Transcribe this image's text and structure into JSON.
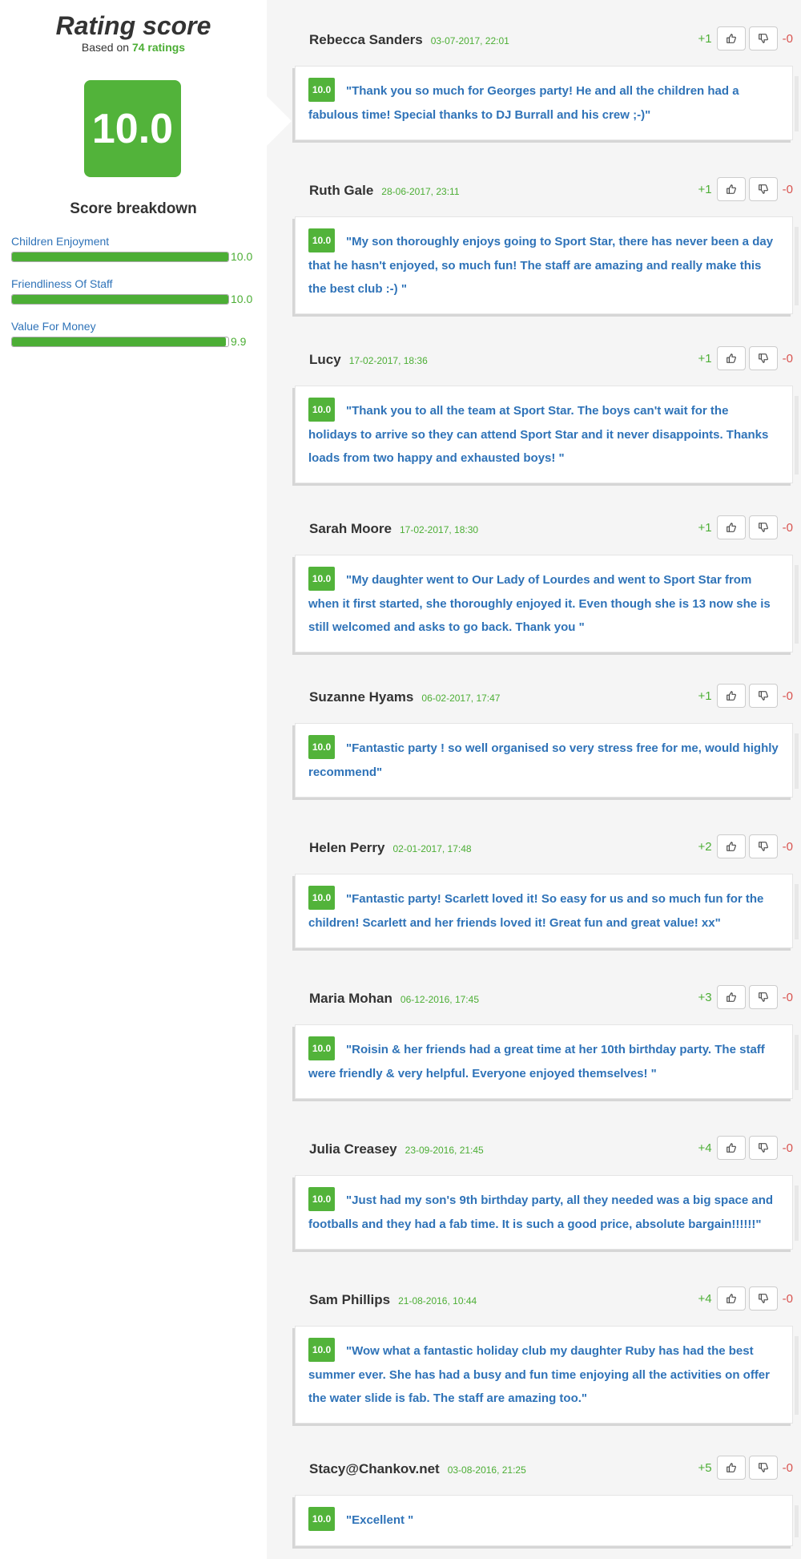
{
  "summary": {
    "title": "Rating score",
    "based_on_prefix": "Based on",
    "rating_count": "74 ratings",
    "score": "10.0"
  },
  "breakdown": {
    "title": "Score breakdown",
    "criteria": [
      {
        "label": "Children Enjoyment",
        "value": "10.0",
        "fraction": 1.0
      },
      {
        "label": "Friendliness Of Staff",
        "value": "10.0",
        "fraction": 1.0
      },
      {
        "label": "Value For Money",
        "value": "9.9",
        "fraction": 0.99
      }
    ]
  },
  "reviews": [
    {
      "author": "Rebecca Sanders",
      "date": "03-07-2017, 22:01",
      "up": "+1",
      "down": "-0",
      "score": "10.0",
      "text": "\"Thank you so much for Georges party! He and all the children had a fabulous time! Special thanks to DJ Burrall and his crew ;-)\""
    },
    {
      "author": "Ruth Gale",
      "date": "28-06-2017, 23:11",
      "up": "+1",
      "down": "-0",
      "score": "10.0",
      "text": "\"My son thoroughly enjoys going to Sport Star, there has never been a day that he hasn't enjoyed, so much fun! The staff are amazing and really make this the best club :-) \""
    },
    {
      "author": "Lucy",
      "date": "17-02-2017, 18:36",
      "up": "+1",
      "down": "-0",
      "score": "10.0",
      "text": "\"Thank you to all the team at Sport Star. The boys can't wait for the holidays to arrive so they can attend Sport Star and it never disappoints. Thanks loads from two happy and exhausted boys! \""
    },
    {
      "author": "Sarah Moore",
      "date": "17-02-2017, 18:30",
      "up": "+1",
      "down": "-0",
      "score": "10.0",
      "text": "\"My daughter went to Our Lady of Lourdes and went to Sport Star from when it first started, she thoroughly enjoyed it. Even though she is 13 now she is still welcomed and asks to go back. Thank you \""
    },
    {
      "author": "Suzanne Hyams",
      "date": "06-02-2017, 17:47",
      "up": "+1",
      "down": "-0",
      "score": "10.0",
      "text": "\"Fantastic party ! so well organised so very stress free for me, would highly recommend\""
    },
    {
      "author": "Helen Perry",
      "date": "02-01-2017, 17:48",
      "up": "+2",
      "down": "-0",
      "score": "10.0",
      "text": "\"Fantastic party! Scarlett loved it! So easy for us and so much fun for the children! Scarlett and her friends loved it! Great fun and great value! xx\""
    },
    {
      "author": "Maria Mohan",
      "date": "06-12-2016, 17:45",
      "up": "+3",
      "down": "-0",
      "score": "10.0",
      "text": "\"Roisin & her friends had a great time at her 10th birthday party. The staff were friendly & very helpful. Everyone enjoyed themselves! \""
    },
    {
      "author": "Julia Creasey",
      "date": "23-09-2016, 21:45",
      "up": "+4",
      "down": "-0",
      "score": "10.0",
      "text": "\"Just had my son's 9th birthday party, all they needed was a big space and footballs and they had a fab time. It is such a good price, absolute bargain!!!!!!\""
    },
    {
      "author": "Sam Phillips",
      "date": "21-08-2016, 10:44",
      "up": "+4",
      "down": "-0",
      "score": "10.0",
      "text": "\"Wow what a fantastic holiday club my daughter Ruby has had the best summer ever. She has had a busy and fun time enjoying all the activities on offer the water slide is fab. The staff are amazing too.\""
    },
    {
      "author": "Stacy@Chankov.net",
      "date": "03-08-2016, 21:25",
      "up": "+5",
      "down": "-0",
      "score": "10.0",
      "text": "\"Excellent \""
    }
  ]
}
